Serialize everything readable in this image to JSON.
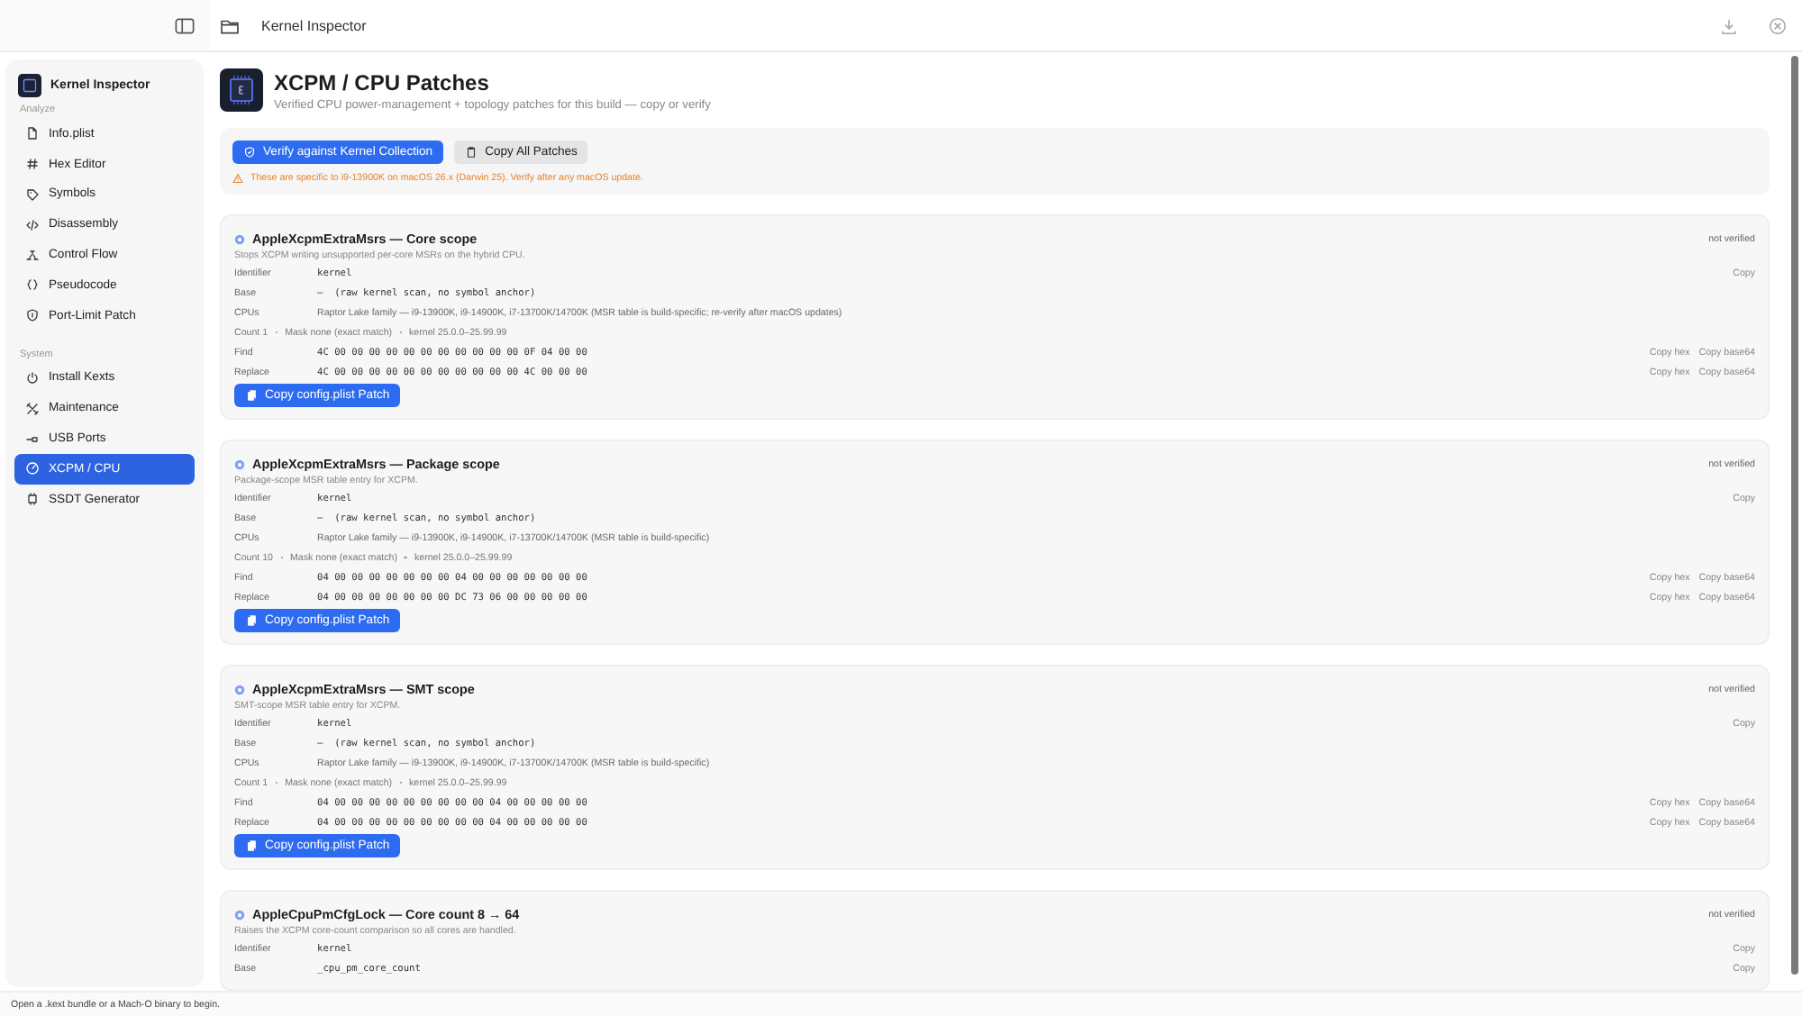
{
  "window": {
    "title": "Kernel Inspector"
  },
  "sidebar": {
    "app_name": "Kernel Inspector",
    "sections": [
      {
        "title": "Analyze",
        "items": [
          {
            "label": "Info.plist",
            "selected": false
          },
          {
            "label": "Hex Editor",
            "selected": false
          },
          {
            "label": "Symbols",
            "selected": false
          },
          {
            "label": "Disassembly",
            "selected": false
          },
          {
            "label": "Control Flow",
            "selected": false
          },
          {
            "label": "Pseudocode",
            "selected": false
          },
          {
            "label": "Port-Limit Patch",
            "selected": false
          }
        ]
      },
      {
        "title": "System",
        "items": [
          {
            "label": "Install Kexts",
            "selected": false
          },
          {
            "label": "Maintenance",
            "selected": false
          },
          {
            "label": "USB Ports",
            "selected": false
          },
          {
            "label": "XCPM / CPU",
            "selected": true
          },
          {
            "label": "SSDT Generator",
            "selected": false
          }
        ]
      }
    ]
  },
  "header": {
    "title": "XCPM / CPU Patches",
    "subtitle": "Verified CPU power-management + topology patches for this build — copy or verify"
  },
  "toolbar": {
    "verify_button": "Verify against Kernel Collection",
    "copy_all_button": "Copy All Patches",
    "warning": "These are specific to i9-13900K on macOS 26.x (Darwin 25). Verify after any macOS update."
  },
  "patches": [
    {
      "title": "AppleXcpmExtraMsrs — Core scope",
      "status": "not verified",
      "description": "Stops XCPM writing unsupported per-core MSRs on the hybrid CPU.",
      "rows": [
        {
          "kind": "mono",
          "label": "Identifier",
          "value": "kernel",
          "actions": [
            "Copy"
          ]
        },
        {
          "kind": "mono",
          "label": "Base",
          "value": "—  (raw kernel scan, no symbol anchor)"
        },
        {
          "kind": "text",
          "label": "CPUs",
          "value": "Raptor Lake family — i9-13900K, i9-14900K, i7-13700K/14700K (MSR table is build-specific; re-verify after macOS updates)"
        },
        {
          "kind": "meta",
          "parts": [
            "Count 1",
            "Mask none (exact match)",
            "kernel 25.0.0–25.99.99"
          ]
        },
        {
          "kind": "mono",
          "label": "Find",
          "value": "4C 00 00 00 00 00 00 00 00 00 00 00 0F 04 00 00",
          "actions": [
            "Copy hex",
            "Copy base64"
          ]
        },
        {
          "kind": "mono",
          "label": "Replace",
          "value": "4C 00 00 00 00 00 00 00 00 00 00 00 4C 00 00 00",
          "actions": [
            "Copy hex",
            "Copy base64"
          ]
        }
      ],
      "button": "Copy config.plist Patch"
    },
    {
      "title": "AppleXcpmExtraMsrs — Package scope",
      "status": "not verified",
      "description": "Package-scope MSR table entry for XCPM.",
      "rows": [
        {
          "kind": "mono",
          "label": "Identifier",
          "value": "kernel",
          "actions": [
            "Copy"
          ]
        },
        {
          "kind": "mono",
          "label": "Base",
          "value": "—  (raw kernel scan, no symbol anchor)"
        },
        {
          "kind": "text",
          "label": "CPUs",
          "value": "Raptor Lake family — i9-13900K, i9-14900K, i7-13700K/14700K (MSR table is build-specific)"
        },
        {
          "kind": "meta",
          "parts": [
            "Count 10",
            "Mask none (exact match)",
            "kernel 25.0.0–25.99.99"
          ]
        },
        {
          "kind": "mono",
          "label": "Find",
          "value": "04 00 00 00 00 00 00 00 04 00 00 00 00 00 00 00",
          "actions": [
            "Copy hex",
            "Copy base64"
          ]
        },
        {
          "kind": "mono",
          "label": "Replace",
          "value": "04 00 00 00 00 00 00 00 DC 73 06 00 00 00 00 00",
          "actions": [
            "Copy hex",
            "Copy base64"
          ]
        }
      ],
      "button": "Copy config.plist Patch"
    },
    {
      "title": "AppleXcpmExtraMsrs — SMT scope",
      "status": "not verified",
      "description": "SMT-scope MSR table entry for XCPM.",
      "rows": [
        {
          "kind": "mono",
          "label": "Identifier",
          "value": "kernel",
          "actions": [
            "Copy"
          ]
        },
        {
          "kind": "mono",
          "label": "Base",
          "value": "—  (raw kernel scan, no symbol anchor)"
        },
        {
          "kind": "text",
          "label": "CPUs",
          "value": "Raptor Lake family — i9-13900K, i9-14900K, i7-13700K/14700K (MSR table is build-specific)"
        },
        {
          "kind": "meta",
          "parts": [
            "Count 1",
            "Mask none (exact match)",
            "kernel 25.0.0–25.99.99"
          ]
        },
        {
          "kind": "mono",
          "label": "Find",
          "value": "04 00 00 00 00 00 00 00 00 00 04 00 00 00 00 00",
          "actions": [
            "Copy hex",
            "Copy base64"
          ]
        },
        {
          "kind": "mono",
          "label": "Replace",
          "value": "04 00 00 00 00 00 00 00 00 00 04 00 00 00 00 00",
          "actions": [
            "Copy hex",
            "Copy base64"
          ]
        }
      ],
      "button": "Copy config.plist Patch"
    },
    {
      "title": "AppleCpuPmCfgLock — Core count 8 → 64",
      "status": "not verified",
      "description": "Raises the XCPM core-count comparison so all cores are handled.",
      "rows": [
        {
          "kind": "mono",
          "label": "Identifier",
          "value": "kernel",
          "actions": [
            "Copy"
          ]
        },
        {
          "kind": "mono",
          "label": "Base",
          "value": "_cpu_pm_core_count",
          "actions": [
            "Copy"
          ]
        }
      ]
    }
  ],
  "status_bar": "Open a .kext bundle or a Mach-O binary to begin."
}
